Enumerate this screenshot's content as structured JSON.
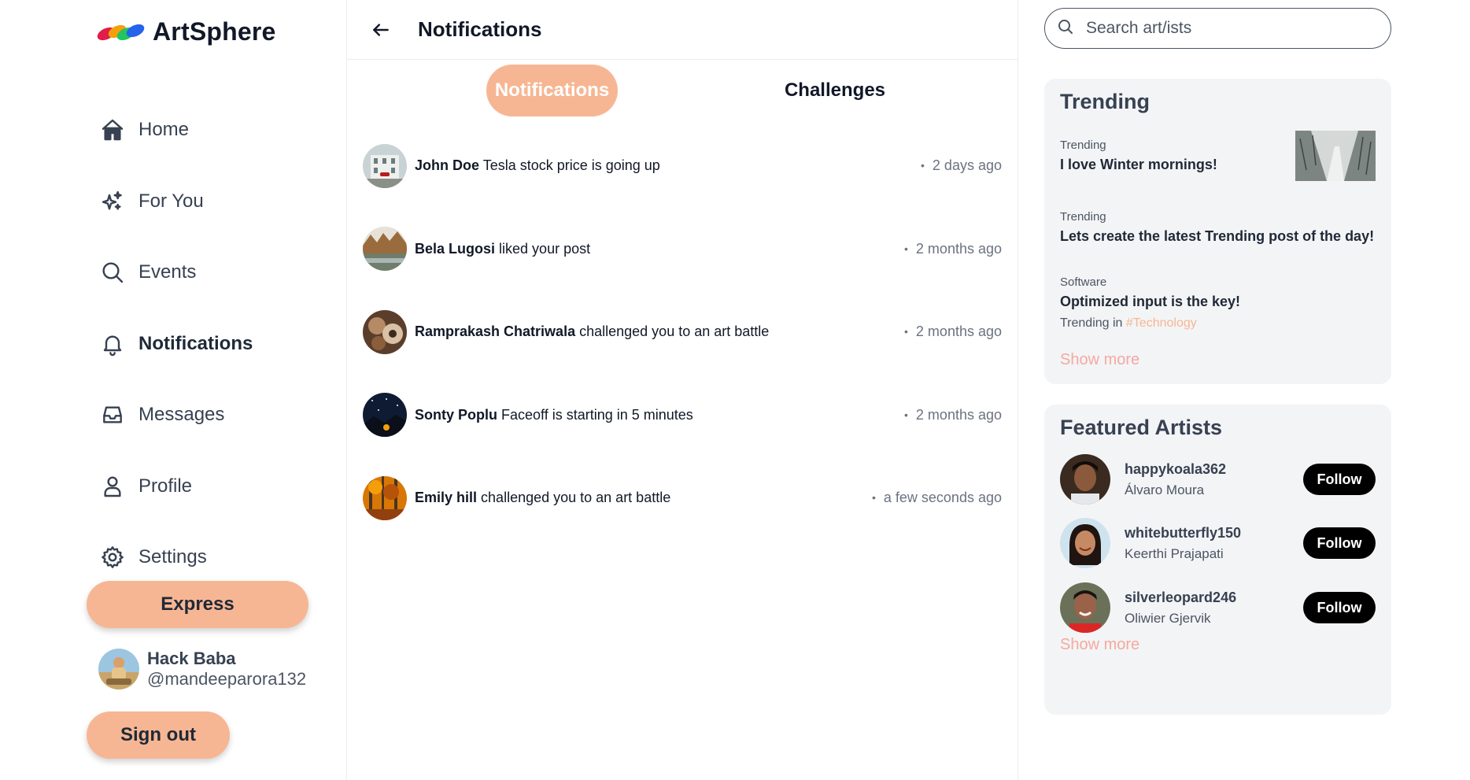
{
  "app": {
    "name": "ArtSphere"
  },
  "nav": {
    "items": [
      {
        "label": "Home",
        "icon": "home-icon"
      },
      {
        "label": "For You",
        "icon": "sparkles-icon"
      },
      {
        "label": "Events",
        "icon": "search-icon"
      },
      {
        "label": "Notifications",
        "icon": "bell-icon",
        "active": true
      },
      {
        "label": "Messages",
        "icon": "inbox-icon"
      },
      {
        "label": "Profile",
        "icon": "user-icon"
      },
      {
        "label": "Settings",
        "icon": "gear-icon"
      }
    ],
    "express_label": "Express",
    "signout_label": "Sign out"
  },
  "user": {
    "name": "Hack Baba",
    "handle": "@mandeeparora132"
  },
  "main": {
    "title": "Notifications",
    "tabs": [
      {
        "label": "Notifications",
        "active": true
      },
      {
        "label": "Challenges",
        "active": false
      }
    ],
    "notifications": [
      {
        "actor": "John Doe",
        "text": "Tesla stock price is going up",
        "time": "2 days ago"
      },
      {
        "actor": "Bela Lugosi",
        "text": "liked your post",
        "time": "2 months ago"
      },
      {
        "actor": "Ramprakash Chatriwala",
        "text": "challenged you to an art battle",
        "time": "2 months ago"
      },
      {
        "actor": "Sonty Poplu",
        "text": "Faceoff is starting in 5 minutes",
        "time": "2 months ago"
      },
      {
        "actor": "Emily hill",
        "text": "challenged you to an art battle",
        "time": "a few seconds ago"
      }
    ]
  },
  "search": {
    "placeholder": "Search art/ists"
  },
  "trending": {
    "title": "Trending",
    "items": [
      {
        "category": "Trending",
        "headline": "I love Winter mornings!"
      },
      {
        "category": "Trending",
        "headline": "Lets create the latest Trending post of the day!"
      },
      {
        "category": "Software",
        "headline": "Optimized input is the key!",
        "meta_prefix": "Trending in",
        "tag": "#Technology"
      }
    ],
    "show_more": "Show more"
  },
  "featured": {
    "title": "Featured Artists",
    "artists": [
      {
        "handle": "happykoala362",
        "name": "Álvaro Moura",
        "follow_label": "Follow"
      },
      {
        "handle": "whitebutterfly150",
        "name": "Keerthi Prajapati",
        "follow_label": "Follow"
      },
      {
        "handle": "silverleopard246",
        "name": "Oliwier Gjervik",
        "follow_label": "Follow"
      }
    ],
    "show_more": "Show more"
  },
  "colors": {
    "accent": "#f7b693",
    "show_more": "#f4a9a0",
    "card_bg": "#f3f4f6",
    "follow_bg": "#000000"
  }
}
